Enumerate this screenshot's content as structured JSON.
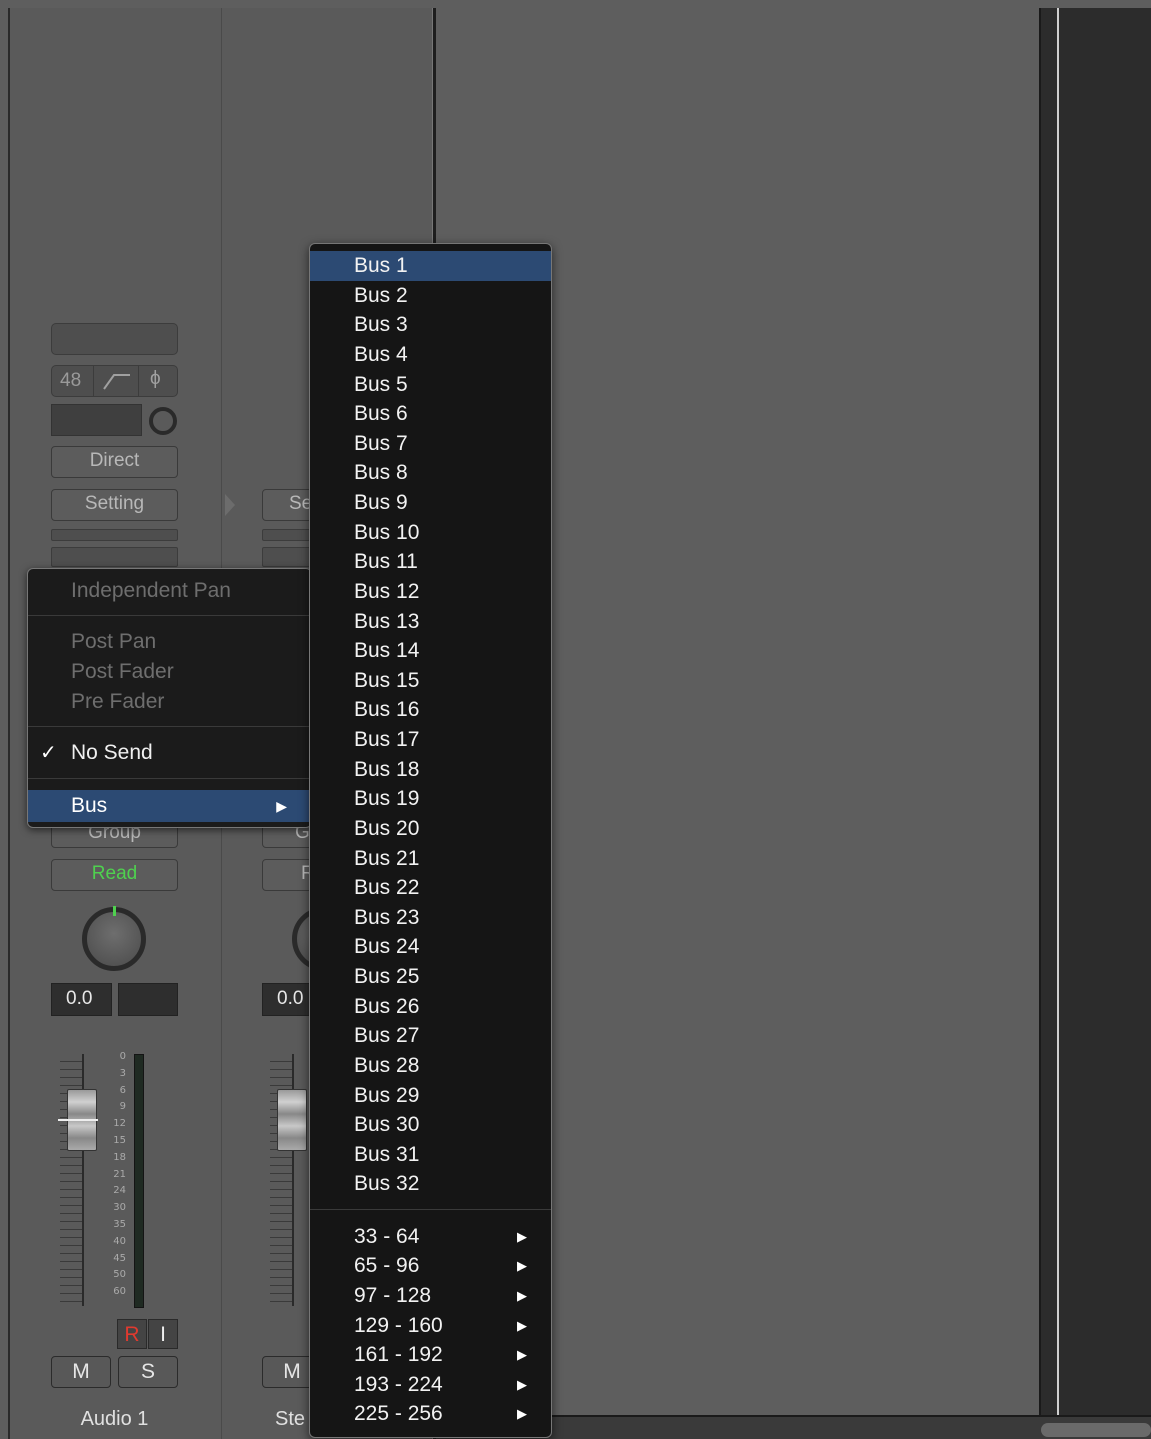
{
  "channel1": {
    "input_format": "48",
    "direct_label": "Direct",
    "setting_label": "Setting",
    "group_label": "Group",
    "automation_label": "Read",
    "volume_value": "0.0",
    "record_label": "R",
    "input_label": "I",
    "mute_label": "M",
    "solo_label": "S",
    "name": "Audio 1",
    "meter_scale": [
      "0",
      "3",
      "6",
      "9",
      "12",
      "15",
      "18",
      "21",
      "24",
      "30",
      "35",
      "40",
      "45",
      "50",
      "60"
    ]
  },
  "channel2": {
    "setting_label_partial": "Se",
    "group_label_partial": "G",
    "automation_label_partial": "R",
    "volume_value": "0.0",
    "mute_label": "M",
    "name_partial": "Ste"
  },
  "send_menu": {
    "items": [
      {
        "label": "Independent Pan",
        "state": "disabled"
      },
      {
        "label": "Post Pan",
        "state": "disabled"
      },
      {
        "label": "Post Fader",
        "state": "disabled"
      },
      {
        "label": "Pre Fader",
        "state": "disabled"
      },
      {
        "label": "No Send",
        "state": "checked"
      },
      {
        "label": "Bus",
        "state": "highlighted"
      }
    ],
    "checkmark": "✓",
    "submenu_arrow": "▶"
  },
  "bus_menu": {
    "buses": [
      "Bus 1",
      "Bus 2",
      "Bus 3",
      "Bus 4",
      "Bus 5",
      "Bus 6",
      "Bus 7",
      "Bus 8",
      "Bus 9",
      "Bus 10",
      "Bus 11",
      "Bus 12",
      "Bus 13",
      "Bus 14",
      "Bus 15",
      "Bus 16",
      "Bus 17",
      "Bus 18",
      "Bus 19",
      "Bus 20",
      "Bus 21",
      "Bus 22",
      "Bus 23",
      "Bus 24",
      "Bus 25",
      "Bus 26",
      "Bus 27",
      "Bus 28",
      "Bus 29",
      "Bus 30",
      "Bus 31",
      "Bus 32"
    ],
    "highlighted": "Bus 1",
    "ranges": [
      "33 - 64",
      "65 - 96",
      "97 - 128",
      "129 - 160",
      "161 - 192",
      "193 - 224",
      "225 - 256"
    ]
  },
  "colors": {
    "menu_highlight": "#2c4a73",
    "read_green": "#4fd14f",
    "record_red": "#e03a2f"
  }
}
